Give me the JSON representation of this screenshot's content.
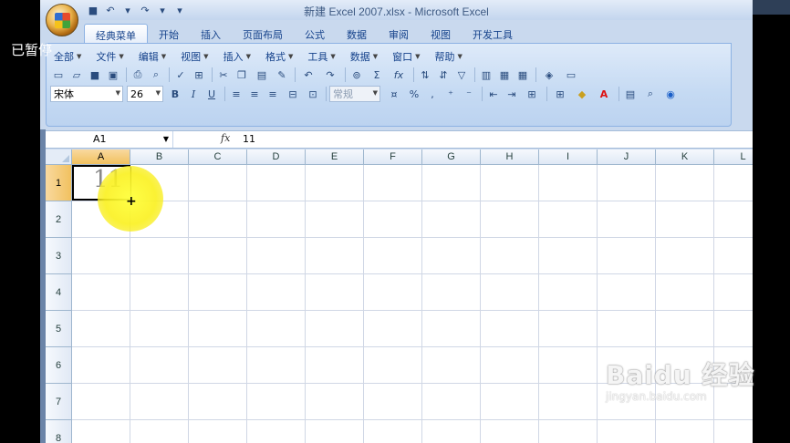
{
  "overlay": {
    "paused_label": "已暂停"
  },
  "window": {
    "title": "新建 Excel 2007.xlsx - Microsoft Excel"
  },
  "quick_access": [
    {
      "icon": "save-icon",
      "glyph": "■"
    },
    {
      "icon": "undo-icon",
      "glyph": "↶"
    },
    {
      "icon": "dropdown-icon",
      "glyph": "▾"
    },
    {
      "icon": "redo-icon",
      "glyph": "↷"
    },
    {
      "icon": "dropdown-icon",
      "glyph": "▾"
    },
    {
      "icon": "customize-icon",
      "glyph": "▾"
    }
  ],
  "tabs": [
    "经典菜单",
    "开始",
    "插入",
    "页面布局",
    "公式",
    "数据",
    "审阅",
    "视图",
    "开发工具"
  ],
  "menus": [
    "全部",
    "文件",
    "编辑",
    "视图",
    "插入",
    "格式",
    "工具",
    "数据",
    "窗口",
    "帮助"
  ],
  "toolbar": {
    "font_name": "宋体",
    "font_size": "26",
    "number_format": "常规",
    "bold": "B",
    "italic": "I",
    "underline": "U",
    "percent": "%",
    "sigma": "Σ",
    "fx": "fx"
  },
  "formula_bar": {
    "name_box": "A1",
    "fx_label": "fx",
    "content": "11"
  },
  "sheet": {
    "columns": [
      "A",
      "B",
      "C",
      "D",
      "E",
      "F",
      "G",
      "H",
      "I",
      "J",
      "K",
      "L"
    ],
    "rows": [
      "1",
      "2",
      "3",
      "4",
      "5",
      "6",
      "7",
      "8"
    ],
    "selected_cell": "A1",
    "a1_value": "11"
  },
  "cursor": {
    "glyph": "+"
  },
  "watermark": {
    "brand": "Baidu 经验",
    "url": "jingyan.baidu.com"
  }
}
